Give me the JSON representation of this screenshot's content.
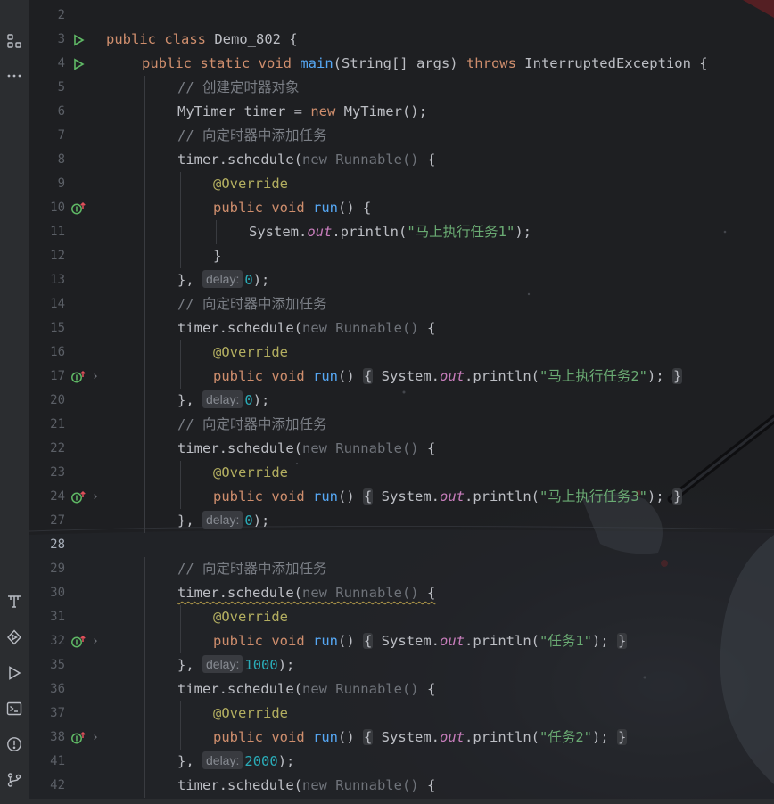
{
  "sidebar": {
    "top_icons": [
      {
        "name": "structure-icon",
        "glyph": "structure"
      },
      {
        "name": "more-icon",
        "glyph": "more"
      }
    ],
    "bottom_icons": [
      {
        "name": "build-icon",
        "glyph": "build"
      },
      {
        "name": "services-icon",
        "glyph": "services"
      },
      {
        "name": "run-icon",
        "glyph": "run"
      },
      {
        "name": "terminal-icon",
        "glyph": "terminal"
      },
      {
        "name": "problems-icon",
        "glyph": "problems"
      },
      {
        "name": "git-icon",
        "glyph": "git"
      }
    ]
  },
  "colors": {
    "keyword": "#cf8e6d",
    "function": "#56a8f5",
    "string": "#6aab73",
    "comment": "#7a7e85",
    "annotation": "#b3ae60",
    "number": "#2aacb8",
    "static_field": "#c77dbb",
    "editor_bg": "#1e1f22"
  },
  "editor": {
    "current_line": "28",
    "lines": [
      {
        "ln": "2",
        "indent": 0,
        "tokens": []
      },
      {
        "ln": "3",
        "indent": 0,
        "g1": "run",
        "tokens": [
          [
            "kw",
            "public "
          ],
          [
            "kw",
            "class "
          ],
          [
            "t",
            "Demo_802 {"
          ]
        ]
      },
      {
        "ln": "4",
        "indent": 1,
        "g1": "run",
        "tokens": [
          [
            "kw",
            "public "
          ],
          [
            "kw",
            "static "
          ],
          [
            "kw",
            "void "
          ],
          [
            "fn",
            "main"
          ],
          [
            "t",
            "(String[] args) "
          ],
          [
            "kw",
            "throws "
          ],
          [
            "t",
            "InterruptedException {"
          ]
        ]
      },
      {
        "ln": "5",
        "indent": 2,
        "tokens": [
          [
            "cmt",
            "// 创建定时器对象"
          ]
        ]
      },
      {
        "ln": "6",
        "indent": 2,
        "tokens": [
          [
            "t",
            "MyTimer timer = "
          ],
          [
            "kw",
            "new "
          ],
          [
            "t",
            "MyTimer();"
          ]
        ]
      },
      {
        "ln": "7",
        "indent": 2,
        "tokens": [
          [
            "cmt",
            "// 向定时器中添加任务"
          ]
        ]
      },
      {
        "ln": "8",
        "indent": 2,
        "tokens": [
          [
            "t",
            "timer.schedule("
          ],
          [
            "dim",
            "new Runnable() "
          ],
          [
            "t",
            "{"
          ]
        ]
      },
      {
        "ln": "9",
        "indent": 3,
        "tokens": [
          [
            "ann",
            "@Override"
          ]
        ]
      },
      {
        "ln": "10",
        "indent": 3,
        "g1": "impl",
        "tokens": [
          [
            "kw",
            "public "
          ],
          [
            "kw",
            "void "
          ],
          [
            "fn",
            "run"
          ],
          [
            "t",
            "() {"
          ]
        ]
      },
      {
        "ln": "11",
        "indent": 4,
        "tokens": [
          [
            "t",
            "System."
          ],
          [
            "fld",
            "out"
          ],
          [
            "t",
            ".println("
          ],
          [
            "str",
            "\"马上执行任务1\""
          ],
          [
            "t",
            ");"
          ]
        ]
      },
      {
        "ln": "12",
        "indent": 3,
        "tokens": [
          [
            "t",
            "}"
          ]
        ]
      },
      {
        "ln": "13",
        "indent": 2,
        "tokens": [
          [
            "t",
            "}, "
          ],
          [
            "hint",
            "delay:"
          ],
          [
            "num",
            "0"
          ],
          [
            "t",
            ");"
          ]
        ]
      },
      {
        "ln": "14",
        "indent": 2,
        "tokens": [
          [
            "cmt",
            "// 向定时器中添加任务"
          ]
        ]
      },
      {
        "ln": "15",
        "indent": 2,
        "tokens": [
          [
            "t",
            "timer.schedule("
          ],
          [
            "dim",
            "new Runnable() "
          ],
          [
            "t",
            "{"
          ]
        ]
      },
      {
        "ln": "16",
        "indent": 3,
        "tokens": [
          [
            "ann",
            "@Override"
          ]
        ]
      },
      {
        "ln": "17",
        "indent": 3,
        "g1": "impl",
        "g2": "›",
        "tokens": [
          [
            "kw",
            "public "
          ],
          [
            "kw",
            "void "
          ],
          [
            "fn",
            "run"
          ],
          [
            "t",
            "() "
          ],
          [
            "fold",
            "{"
          ],
          [
            "t",
            " System."
          ],
          [
            "fld",
            "out"
          ],
          [
            "t",
            ".println("
          ],
          [
            "str",
            "\"马上执行任务2\""
          ],
          [
            "t",
            "); "
          ],
          [
            "fold",
            "}"
          ]
        ]
      },
      {
        "ln": "20",
        "indent": 2,
        "tokens": [
          [
            "t",
            "}, "
          ],
          [
            "hint",
            "delay:"
          ],
          [
            "num",
            "0"
          ],
          [
            "t",
            ");"
          ]
        ]
      },
      {
        "ln": "21",
        "indent": 2,
        "tokens": [
          [
            "cmt",
            "// 向定时器中添加任务"
          ]
        ]
      },
      {
        "ln": "22",
        "indent": 2,
        "tokens": [
          [
            "t",
            "timer.schedule("
          ],
          [
            "dim",
            "new Runnable() "
          ],
          [
            "t",
            "{"
          ]
        ]
      },
      {
        "ln": "23",
        "indent": 3,
        "tokens": [
          [
            "ann",
            "@Override"
          ]
        ]
      },
      {
        "ln": "24",
        "indent": 3,
        "g1": "impl",
        "g2": "›",
        "tokens": [
          [
            "kw",
            "public "
          ],
          [
            "kw",
            "void "
          ],
          [
            "fn",
            "run"
          ],
          [
            "t",
            "() "
          ],
          [
            "fold",
            "{"
          ],
          [
            "t",
            " System."
          ],
          [
            "fld",
            "out"
          ],
          [
            "t",
            ".println("
          ],
          [
            "str",
            "\"马上执行任务3\""
          ],
          [
            "t",
            "); "
          ],
          [
            "fold",
            "}"
          ]
        ]
      },
      {
        "ln": "27",
        "indent": 2,
        "tokens": [
          [
            "t",
            "}, "
          ],
          [
            "hint",
            "delay:"
          ],
          [
            "num",
            "0"
          ],
          [
            "t",
            ");"
          ]
        ]
      },
      {
        "ln": "28",
        "indent": 0,
        "tokens": []
      },
      {
        "ln": "29",
        "indent": 2,
        "tokens": [
          [
            "cmt",
            "// 向定时器中添加任务"
          ]
        ]
      },
      {
        "ln": "30",
        "indent": 2,
        "tokens": [
          [
            "warn",
            "timer.schedule("
          ],
          [
            "dimwarn",
            "new Runnable() "
          ],
          [
            "warn",
            "{"
          ]
        ]
      },
      {
        "ln": "31",
        "indent": 3,
        "tokens": [
          [
            "ann",
            "@Override"
          ]
        ]
      },
      {
        "ln": "32",
        "indent": 3,
        "g1": "impl",
        "g2": "›",
        "tokens": [
          [
            "kw",
            "public "
          ],
          [
            "kw",
            "void "
          ],
          [
            "fn",
            "run"
          ],
          [
            "t",
            "() "
          ],
          [
            "fold",
            "{"
          ],
          [
            "t",
            " System."
          ],
          [
            "fld",
            "out"
          ],
          [
            "t",
            ".println("
          ],
          [
            "str",
            "\"任务1\""
          ],
          [
            "t",
            "); "
          ],
          [
            "fold",
            "}"
          ]
        ]
      },
      {
        "ln": "35",
        "indent": 2,
        "tokens": [
          [
            "t",
            "}, "
          ],
          [
            "hint",
            "delay:"
          ],
          [
            "num",
            "1000"
          ],
          [
            "t",
            ");"
          ]
        ]
      },
      {
        "ln": "36",
        "indent": 2,
        "tokens": [
          [
            "t",
            "timer.schedule("
          ],
          [
            "dim",
            "new Runnable() "
          ],
          [
            "t",
            "{"
          ]
        ]
      },
      {
        "ln": "37",
        "indent": 3,
        "tokens": [
          [
            "ann",
            "@Override"
          ]
        ]
      },
      {
        "ln": "38",
        "indent": 3,
        "g1": "impl",
        "g2": "›",
        "tokens": [
          [
            "kw",
            "public "
          ],
          [
            "kw",
            "void "
          ],
          [
            "fn",
            "run"
          ],
          [
            "t",
            "() "
          ],
          [
            "fold",
            "{"
          ],
          [
            "t",
            " System."
          ],
          [
            "fld",
            "out"
          ],
          [
            "t",
            ".println("
          ],
          [
            "str",
            "\"任务2\""
          ],
          [
            "t",
            "); "
          ],
          [
            "fold",
            "}"
          ]
        ]
      },
      {
        "ln": "41",
        "indent": 2,
        "tokens": [
          [
            "t",
            "}, "
          ],
          [
            "hint",
            "delay:"
          ],
          [
            "num",
            "2000"
          ],
          [
            "t",
            ");"
          ]
        ]
      },
      {
        "ln": "42",
        "indent": 2,
        "tokens": [
          [
            "t",
            "timer.schedule("
          ],
          [
            "dim",
            "new Runnable() "
          ],
          [
            "t",
            "{"
          ]
        ]
      }
    ]
  }
}
